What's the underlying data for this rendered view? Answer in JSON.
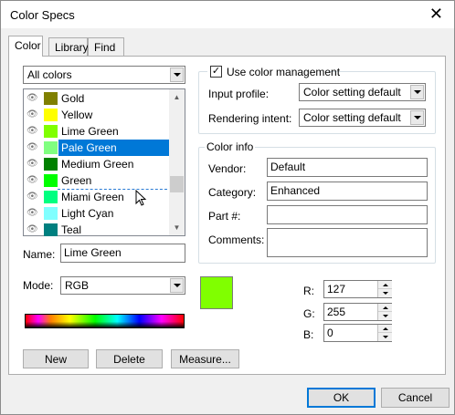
{
  "window": {
    "title": "Color Specs",
    "close_glyph": "✕"
  },
  "tabs": [
    {
      "label": "Color",
      "active": true
    },
    {
      "label": "Library",
      "active": false
    },
    {
      "label": "Find",
      "active": false
    }
  ],
  "filter": {
    "selected": "All colors"
  },
  "color_list": {
    "items": [
      {
        "name": "Gold",
        "color": "#808000",
        "selected": false
      },
      {
        "name": "Yellow",
        "color": "#ffff00",
        "selected": false
      },
      {
        "name": "Lime Green",
        "color": "#80ff00",
        "selected": false
      },
      {
        "name": "Pale Green",
        "color": "#80ff80",
        "selected": true
      },
      {
        "name": "Medium Green",
        "color": "#008000",
        "selected": false
      },
      {
        "name": "Green",
        "color": "#00ff00",
        "selected": false
      },
      {
        "name": "Miami Green",
        "color": "#00ff80",
        "selected": false
      },
      {
        "name": "Light Cyan",
        "color": "#80ffff",
        "selected": false
      },
      {
        "name": "Teal",
        "color": "#008080",
        "selected": false
      }
    ],
    "eye_icon": "👁"
  },
  "name_field": {
    "label": "Name:",
    "value": "Lime Green"
  },
  "mode": {
    "label": "Mode:",
    "selected": "RGB"
  },
  "buttons": {
    "new": "New",
    "delete": "Delete",
    "measure": "Measure..."
  },
  "color_management": {
    "checkbox_label": "Use color management",
    "checked": true,
    "check_glyph": "✓",
    "input_profile_label": "Input profile:",
    "input_profile_value": "Color setting default",
    "rendering_intent_label": "Rendering intent:",
    "rendering_intent_value": "Color setting default"
  },
  "color_info": {
    "legend": "Color info",
    "vendor_label": "Vendor:",
    "vendor_value": "Default",
    "category_label": "Category:",
    "category_value": "Enhanced",
    "part_label": "Part #:",
    "part_value": "",
    "comments_label": "Comments:",
    "comments_value": ""
  },
  "preview_color": "#80ff00",
  "rgb": {
    "r_label": "R:",
    "r_value": "127",
    "g_label": "G:",
    "g_value": "255",
    "b_label": "B:",
    "b_value": "0"
  },
  "footer": {
    "ok": "OK",
    "cancel": "Cancel"
  }
}
